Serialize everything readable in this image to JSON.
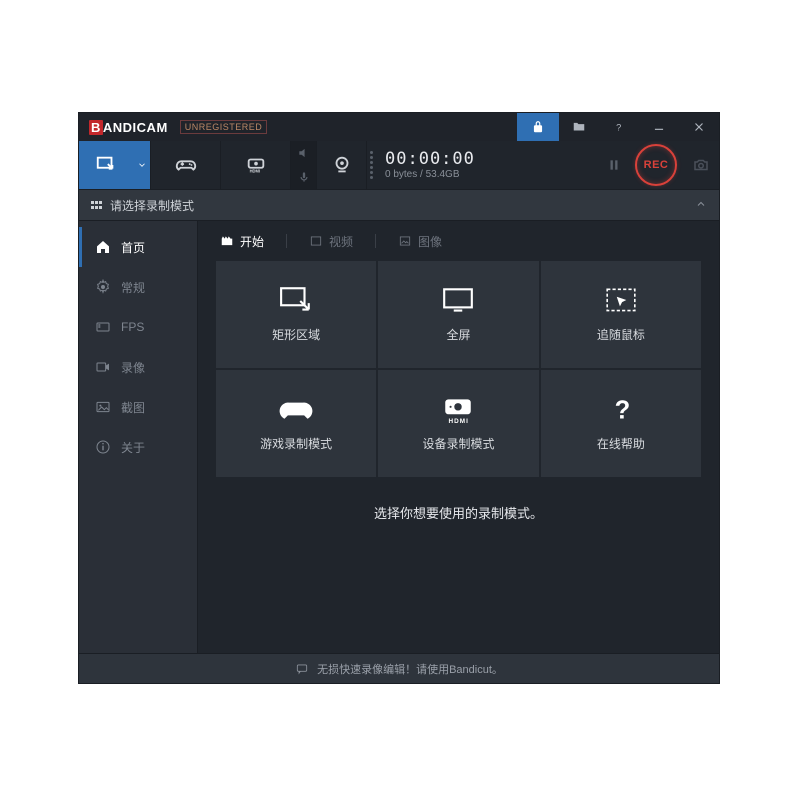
{
  "titlebar": {
    "brand_prefix": "B",
    "brand_rest": "ANDICAM",
    "unregistered": "UNREGISTERED"
  },
  "toolbar": {
    "timer": "00:00:00",
    "size_status": "0 bytes / 53.4GB",
    "rec_label": "REC"
  },
  "modestrip": {
    "text": "请选择录制模式"
  },
  "sidebar": {
    "items": [
      {
        "label": "首页"
      },
      {
        "label": "常规"
      },
      {
        "label": "FPS"
      },
      {
        "label": "录像"
      },
      {
        "label": "截图"
      },
      {
        "label": "关于"
      }
    ]
  },
  "tabs": {
    "start": "开始",
    "video": "视频",
    "image": "图像"
  },
  "cards": [
    {
      "label": "矩形区域"
    },
    {
      "label": "全屏"
    },
    {
      "label": "追随鼠标"
    },
    {
      "label": "游戏录制模式"
    },
    {
      "label": "设备录制模式"
    },
    {
      "label": "在线帮助"
    }
  ],
  "caption": "选择你想要使用的录制模式。",
  "footer": {
    "text": "无损快速录像编辑！请使用Bandicut。"
  }
}
